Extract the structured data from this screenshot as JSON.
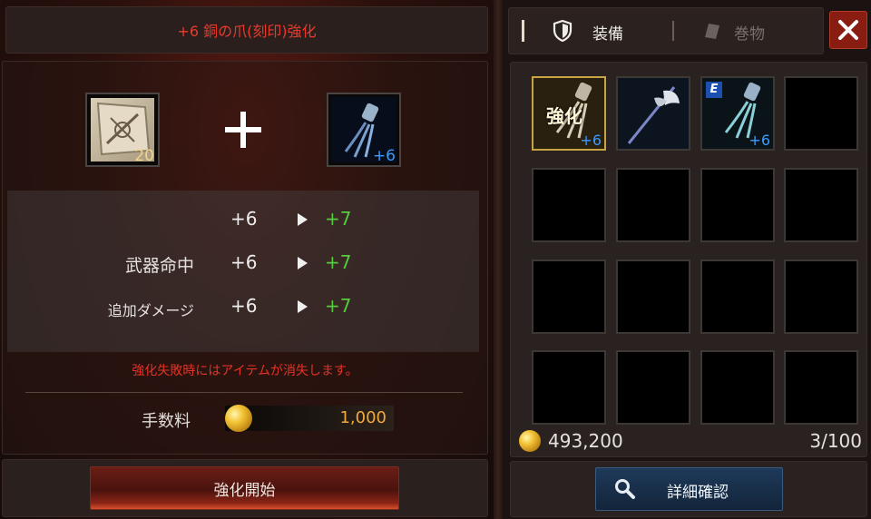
{
  "enhance": {
    "title": "+6 銅の爪(刻印)強化",
    "material": {
      "icon": "enhancement-scroll-icon",
      "count": "20"
    },
    "target": {
      "icon": "claw-weapon-icon",
      "level": "+6"
    },
    "stats": [
      {
        "label": "",
        "from": "+6",
        "to": "+7"
      },
      {
        "label": "武器命中",
        "from": "+6",
        "to": "+7"
      },
      {
        "label": "追加ダメージ",
        "from": "+6",
        "to": "+7"
      }
    ],
    "warning": "強化失敗時にはアイテムが消失します。",
    "fee_label": "手数料",
    "fee_value": "1,000",
    "start_button": "強化開始"
  },
  "tabs": {
    "equip": {
      "label": "装備",
      "icon": "shield-icon",
      "active": true
    },
    "scroll": {
      "label": "巻物",
      "icon": "scroll-icon",
      "active": false
    }
  },
  "close_icon": "close-icon",
  "inventory": {
    "items": [
      {
        "icon": "claw-weapon-icon",
        "badge": "強化",
        "level": "+6",
        "selected": true
      },
      {
        "icon": "halberd-icon",
        "level": ""
      },
      {
        "icon": "claw-weapon-icon",
        "level": "+6",
        "equipped_tag": "E"
      }
    ],
    "coin_amount": "493,200",
    "capacity": "3/100"
  },
  "detail_button": "詳細確認",
  "colors": {
    "accent_red": "#e83b2e",
    "stat_green": "#55cc3c",
    "gold": "#f2a93a",
    "level_blue": "#3b9bff"
  }
}
